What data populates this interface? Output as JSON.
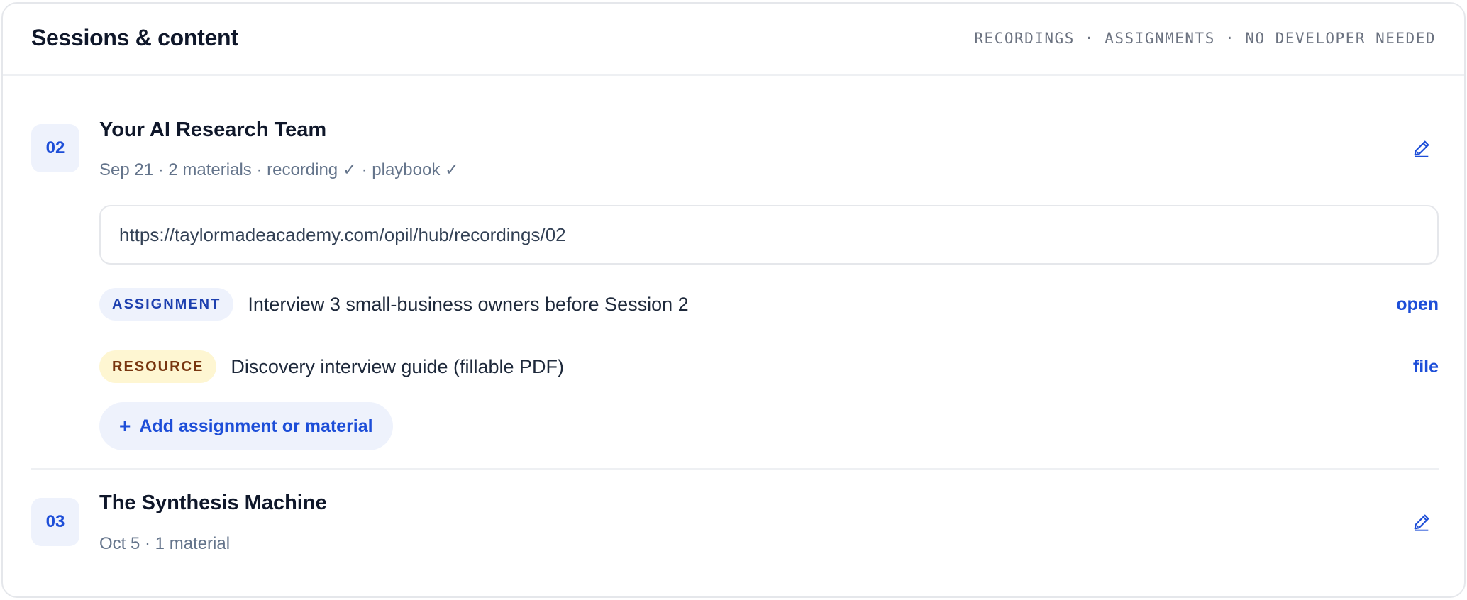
{
  "header": {
    "title": "Sessions & content",
    "tagline": "RECORDINGS · ASSIGNMENTS · NO DEVELOPER NEEDED"
  },
  "sessions": [
    {
      "number": "02",
      "title": "Your AI Research Team",
      "meta": "Sep 21 · 2 materials · recording ✓ · playbook ✓",
      "recording_url": "https://taylormadeacademy.com/opil/hub/recordings/02",
      "items": [
        {
          "tag": "ASSIGNMENT",
          "text": "Interview 3 small-business owners before Session 2",
          "action": "open"
        },
        {
          "tag": "RESOURCE",
          "text": "Discovery interview guide (fillable PDF)",
          "action": "file"
        }
      ],
      "add_label": "Add assignment or material",
      "add_icon": "+"
    },
    {
      "number": "03",
      "title": "The Synthesis Machine",
      "meta": "Oct 5 · 1 material"
    }
  ],
  "colors": {
    "accent": "#1d4ed8",
    "assignment_tag_bg": "#eef2fc",
    "resource_tag_bg": "#fef6d2",
    "resource_tag_text": "#78350f"
  },
  "icons": {
    "edit": "pencil-icon",
    "add": "plus-icon"
  }
}
